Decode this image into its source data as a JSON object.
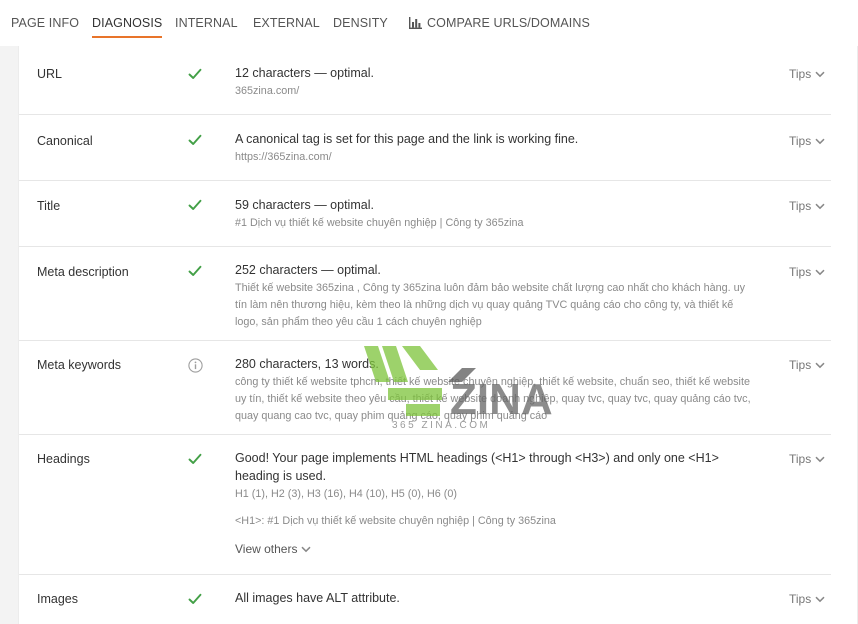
{
  "tabs": [
    {
      "id": "page-info",
      "label": "PAGE INFO",
      "active": false
    },
    {
      "id": "diagnosis",
      "label": "DIAGNOSIS",
      "active": true
    },
    {
      "id": "internal",
      "label": "INTERNAL",
      "active": false
    },
    {
      "id": "external",
      "label": "EXTERNAL",
      "active": false
    },
    {
      "id": "density",
      "label": "DENSITY",
      "active": false
    },
    {
      "id": "compare",
      "label": "COMPARE URLS/DOMAINS",
      "active": false,
      "icon": "bar-chart-icon"
    }
  ],
  "tips_label": "Tips",
  "colors": {
    "accent": "#e8742a",
    "check": "#43a047",
    "info": "#9e9e9e"
  },
  "rows": [
    {
      "label": "URL",
      "status": "check",
      "main": "12 characters — optimal.",
      "sub": "365zina.com/"
    },
    {
      "label": "Canonical",
      "status": "check",
      "main": "A canonical tag is set for this page and the link is working fine.",
      "sub": "https://365zina.com/"
    },
    {
      "label": "Title",
      "status": "check",
      "main": "59 characters — optimal.",
      "sub": "#1 Dịch vụ thiết kế website chuyên nghiệp | Công ty 365zina"
    },
    {
      "label": "Meta description",
      "status": "check",
      "main": "252 characters — optimal.",
      "sub": "Thiết kế website 365zina , Công ty 365zina luôn đảm bảo website chất lượng cao nhất cho khách hàng. uy tín làm nên thương hiệu, kèm theo là những dịch vụ quay quảng TVC quảng cáo cho công ty, và thiết kế logo, sản phẩm theo yêu cầu 1 cách chuyên nghiệp"
    },
    {
      "label": "Meta keywords",
      "status": "info",
      "main": "280 characters, 13 words.",
      "sub": "công ty thiết kế website tphcm, thiết kế website chuyên nghiệp, thiết kế website, chuẩn seo, thiết kế website uy tín, thiết kế website theo yêu cầu, thiết kế website doanh nghiệp, quay tvc, quay tvc, quay quảng cáo tvc, quay quang cao tvc, quay phim quảng cáo, quay phim quảng cáo"
    },
    {
      "label": "Headings",
      "status": "check",
      "main": "Good! Your page implements HTML headings (<H1> through <H3>) and only one <H1> heading is used.",
      "sub": "H1 (1), H2 (3), H3 (16), H4 (10), H5 (0), H6 (0)",
      "sub2": "<H1>: #1 Dịch vụ thiết kế website chuyên nghiệp | Công ty 365zina",
      "view_others": "View others"
    },
    {
      "label": "Images",
      "status": "check",
      "main": "All images have ALT attribute."
    }
  ],
  "watermark": {
    "brand": "ZINA",
    "tagline": "365 ZINA.COM"
  }
}
